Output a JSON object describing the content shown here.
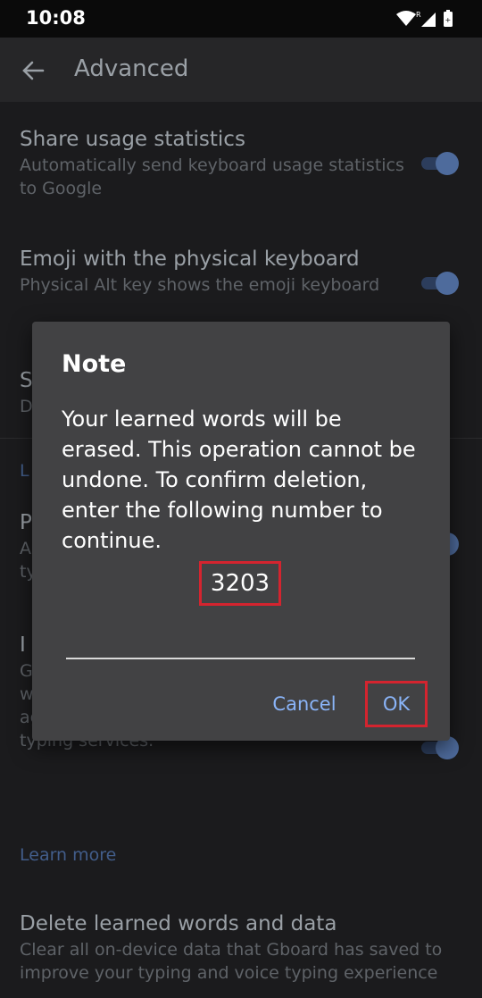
{
  "status_bar": {
    "time": "10:08",
    "icons": [
      "wifi-icon",
      "signal-icon",
      "battery-icon"
    ]
  },
  "app_bar": {
    "back_icon": "arrow-back-icon",
    "title": "Advanced"
  },
  "settings": [
    {
      "title": "Share usage statistics",
      "summary": "Automatically send keyboard usage statistics to Google",
      "toggle": true
    },
    {
      "title": "Emoji with the physical keyboard",
      "summary": "Physical Alt key shows the emoji keyboard",
      "toggle": true
    },
    {
      "title": "S",
      "summary": "D"
    },
    {
      "section": "L"
    },
    {
      "title": "P",
      "summary": "A ty",
      "toggle": true
    },
    {
      "title": "I e",
      "summary": "G o patterns. With your permission, Gboard will use these improvements, in the aggregate, to update Google's voice and typing services.",
      "toggle": true
    },
    {
      "link": "Learn more"
    },
    {
      "title": "Delete learned words and data",
      "summary": "Clear all on-device data that Gboard has saved to improve your typing and voice typing experience"
    }
  ],
  "dialog": {
    "title": "Note",
    "message": "Your learned words will be erased. This operation cannot be undone. To confirm deletion, enter the following number to continue.",
    "confirm_number": "3203",
    "input_value": "",
    "cancel_label": "Cancel",
    "ok_label": "OK",
    "highlight_color": "#d4242f",
    "accent_color": "#8ab4f8"
  }
}
